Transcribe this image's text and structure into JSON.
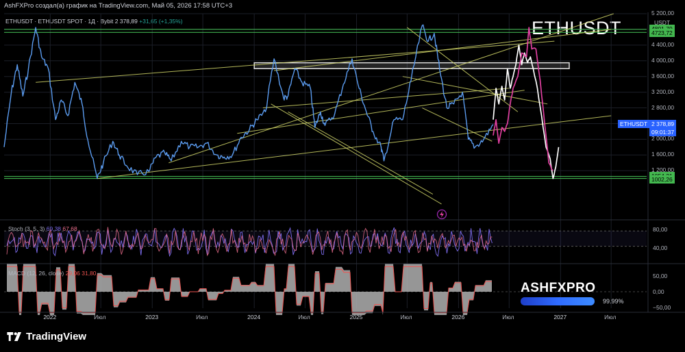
{
  "window": {
    "caption": "AshFXPro создал(а) график на TradingView.com, Май 05, 2026 17:58 UTC+3"
  },
  "legend": {
    "symbol": "ETHUSDT · ETHUSDT SPOT · 1Д · Bybit",
    "price": "2 378,89",
    "change": "+31,65 (+1,35%)"
  },
  "chart_title": "ETHUSDT",
  "currency": "USDT",
  "colors": {
    "price_line": "#5b9cf0",
    "projection_white": "#ffffff",
    "projection_magenta": "#e040a0",
    "trend_yellow": "#d4d86a",
    "level_green": "#49c95a",
    "stoch_k": "#7e6df0",
    "stoch_d": "#ee6f8e"
  },
  "price_tags": [
    {
      "label": "4801,79",
      "bg": "#43b84f",
      "fg": "#000000"
    },
    {
      "label": "4723,72",
      "bg": "#43b84f",
      "fg": "#000000"
    },
    {
      "label": "ETHUSDT",
      "bg": "#2962ff",
      "fg": "#ffffff"
    },
    {
      "label": "2 378,89",
      "bg": "#2962ff",
      "fg": "#ffffff"
    },
    {
      "label": "09:01:37",
      "bg": "#2962ff",
      "fg": "#ffffff"
    },
    {
      "label": "1054,31",
      "bg": "#43b84f",
      "fg": "#000000"
    },
    {
      "label": "1002,26",
      "bg": "#43b84f",
      "fg": "#000000"
    }
  ],
  "stoch": {
    "label": "Stoch (3, 5, 3)",
    "k_value": "69,38",
    "d_value": "67,68",
    "ticks": [
      "80,00",
      "40,00"
    ]
  },
  "macd": {
    "label": "MACD (12, 26, close)",
    "values": "29,06   31,80",
    "ticks": [
      "50,00",
      "0,00",
      "−50,00"
    ]
  },
  "watermark": {
    "brand": "ASHFXPRO",
    "progress": 0.9999,
    "progress_text": "99.99%"
  },
  "footer": {
    "brand": "TradingView"
  },
  "chart_data": {
    "type": "line",
    "title": "ETHUSDT",
    "ylabel": "USDT",
    "ylim": [
      0,
      5200
    ],
    "y_ticks": [
      5200,
      4800,
      4400,
      4000,
      3600,
      3200,
      2800,
      2400,
      2000,
      1600,
      1200
    ],
    "y_tick_labels": [
      "5 200,00",
      "4 800,00",
      "4 400,00",
      "4 000,00",
      "3 600,00",
      "3 200,00",
      "2 800,00",
      "2 400,00",
      "2 000,00",
      "1 600,00",
      "1 200,00"
    ],
    "x_tick_labels": [
      "2022",
      "Июл",
      "2023",
      "Июл",
      "2024",
      "Июл",
      "2025",
      "Июл",
      "2026",
      "Июл",
      "2027",
      "Июл"
    ],
    "x_tick_dates": [
      "2022-01-01",
      "2022-07-01",
      "2023-01-01",
      "2023-07-01",
      "2024-01-01",
      "2024-07-01",
      "2025-01-01",
      "2025-07-01",
      "2026-01-01",
      "2026-07-01",
      "2027-01-01",
      "2027-07-01"
    ],
    "levels": [
      4801.79,
      4723.72,
      1054.31,
      1002.26
    ],
    "zone": {
      "from": 3800,
      "to": 3950,
      "start": "2024-01-01",
      "end": "2027-02-01"
    },
    "series": [
      {
        "name": "ETHUSDT",
        "x": [
          "2021-07-20",
          "2021-08-15",
          "2021-09-05",
          "2021-09-25",
          "2021-10-15",
          "2021-11-10",
          "2021-12-01",
          "2021-12-25",
          "2022-01-20",
          "2022-02-10",
          "2022-03-05",
          "2022-03-30",
          "2022-04-25",
          "2022-05-15",
          "2022-06-18",
          "2022-07-10",
          "2022-08-13",
          "2022-09-05",
          "2022-10-01",
          "2022-11-09",
          "2022-12-20",
          "2023-01-15",
          "2023-02-15",
          "2023-03-10",
          "2023-04-15",
          "2023-05-15",
          "2023-06-15",
          "2023-07-15",
          "2023-08-20",
          "2023-09-15",
          "2023-10-15",
          "2023-11-15",
          "2023-12-15",
          "2024-01-10",
          "2024-02-10",
          "2024-03-12",
          "2024-04-15",
          "2024-05-01",
          "2024-05-25",
          "2024-06-20",
          "2024-07-20",
          "2024-08-05",
          "2024-08-25",
          "2024-09-10",
          "2024-10-15",
          "2024-11-15",
          "2024-12-16",
          "2025-01-10",
          "2025-02-05",
          "2025-03-01",
          "2025-03-30",
          "2025-04-09",
          "2025-05-15",
          "2025-06-15",
          "2025-07-15",
          "2025-08-24",
          "2025-09-15",
          "2025-10-06",
          "2025-10-25",
          "2025-11-20",
          "2025-12-15",
          "2026-01-15",
          "2026-02-05",
          "2026-03-01",
          "2026-04-01",
          "2026-05-05"
        ],
        "y": [
          1800,
          3200,
          3900,
          3100,
          3800,
          4850,
          4100,
          3800,
          2500,
          3000,
          2600,
          3450,
          2900,
          2000,
          1000,
          1400,
          1950,
          1600,
          1330,
          1100,
          1180,
          1550,
          1650,
          1450,
          1950,
          1800,
          1800,
          1900,
          1600,
          1550,
          1600,
          2050,
          2250,
          2500,
          2700,
          4050,
          3050,
          3100,
          3800,
          3450,
          3300,
          2300,
          2700,
          2350,
          2650,
          3400,
          4050,
          3300,
          2700,
          2200,
          1800,
          1450,
          2500,
          2500,
          3500,
          4900,
          4500,
          4700,
          3800,
          2800,
          2900,
          3200,
          2000,
          1800,
          2000,
          2378.89
        ]
      },
      {
        "name": "projection-white",
        "x": [
          "2026-05-05",
          "2026-05-15",
          "2026-05-25",
          "2026-06-05",
          "2026-06-15",
          "2026-06-25",
          "2026-07-05",
          "2026-07-15",
          "2026-07-25",
          "2026-08-05",
          "2026-08-15",
          "2026-08-25",
          "2026-09-05",
          "2026-09-15",
          "2026-09-25",
          "2026-10-10",
          "2026-10-25",
          "2026-11-10",
          "2026-11-25",
          "2026-12-05",
          "2026-12-15",
          "2026-12-25"
        ],
        "y": [
          2500,
          3300,
          2900,
          3350,
          3000,
          3800,
          3300,
          3600,
          3900,
          4400,
          3900,
          4200,
          3950,
          4100,
          3800,
          3300,
          2600,
          1800,
          1500,
          1000,
          1300,
          1800
        ]
      },
      {
        "name": "projection-magenta",
        "x": [
          "2026-05-05",
          "2026-05-15",
          "2026-05-25",
          "2026-06-05",
          "2026-06-15",
          "2026-06-25",
          "2026-07-05",
          "2026-07-15",
          "2026-08-01",
          "2026-08-15",
          "2026-09-01",
          "2026-09-10",
          "2026-09-20",
          "2026-10-05",
          "2026-10-20",
          "2026-11-05",
          "2026-11-20",
          "2026-12-05"
        ],
        "y": [
          2100,
          2500,
          1900,
          2300,
          2200,
          2400,
          2900,
          3300,
          3600,
          4200,
          4100,
          4850,
          4300,
          4300,
          3500,
          2400,
          1400,
          1200
        ]
      }
    ],
    "trendlines": [
      {
        "from": [
          "2021-11-10",
          3450
        ],
        "to": [
          "2026-12-10",
          4500
        ]
      },
      {
        "from": [
          "2022-06-18",
          1000
        ],
        "to": [
          "2027-07-01",
          2600
        ]
      },
      {
        "from": [
          "2023-03-01",
          1400
        ],
        "to": [
          "2027-07-10",
          5200
        ]
      },
      {
        "from": [
          "2023-11-01",
          2150
        ],
        "to": [
          "2026-08-25",
          3250
        ]
      },
      {
        "from": [
          "2024-03-12",
          3750
        ],
        "to": [
          "2027-07-01",
          4800
        ]
      },
      {
        "from": [
          "2024-02-01",
          2800
        ],
        "to": [
          "2026-07-01",
          3300
        ]
      },
      {
        "from": [
          "2024-03-01",
          2900
        ],
        "to": [
          "2025-11-01",
          350
        ]
      },
      {
        "from": [
          "2024-05-01",
          2700
        ],
        "to": [
          "2025-10-01",
          600
        ]
      },
      {
        "from": [
          "2025-06-15",
          3600
        ],
        "to": [
          "2026-11-15",
          2900
        ]
      },
      {
        "from": [
          "2025-07-01",
          4850
        ],
        "to": [
          "2026-08-01",
          2700
        ]
      },
      {
        "from": [
          "2025-08-24",
          2800
        ],
        "to": [
          "2026-05-01",
          1950
        ]
      }
    ]
  }
}
